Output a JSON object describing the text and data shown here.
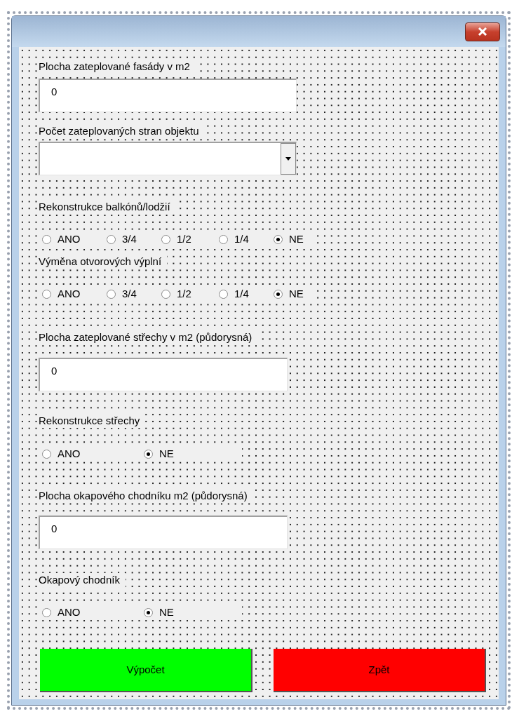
{
  "fields": [
    {
      "kind": "text",
      "label": "Plocha zateplované fasády v m2",
      "value": "0"
    },
    {
      "kind": "dropdown",
      "label": "Počet zateplovaných stran objektu"
    },
    {
      "kind": "radio",
      "label": "Rekonstrukce balkónů/lodžií",
      "options": [
        {
          "label": "ANO",
          "selected": false
        },
        {
          "label": "3/4",
          "selected": false
        },
        {
          "label": "1/2",
          "selected": false
        },
        {
          "label": "1/4",
          "selected": false
        },
        {
          "label": "NE",
          "selected": true
        }
      ]
    },
    {
      "kind": "radio",
      "label": "Výměna otvorových výplní",
      "options": [
        {
          "label": "ANO",
          "selected": false
        },
        {
          "label": "3/4",
          "selected": false
        },
        {
          "label": "1/2",
          "selected": false
        },
        {
          "label": "1/4",
          "selected": false
        },
        {
          "label": "NE",
          "selected": true
        }
      ]
    },
    {
      "kind": "text",
      "label": "Plocha zateplované střechy v m2 (půdorysná)",
      "value": "0"
    },
    {
      "kind": "radio",
      "label": "Rekonstrukce střechy",
      "options": [
        {
          "label": "ANO",
          "selected": false
        },
        {
          "label": "NE",
          "selected": true
        }
      ]
    },
    {
      "kind": "text",
      "label": "Plocha okapového chodníku m2 (půdorysná)",
      "value": "0"
    },
    {
      "kind": "radio",
      "label": "Okapový chodník",
      "options": [
        {
          "label": "ANO",
          "selected": false
        },
        {
          "label": "NE",
          "selected": true
        }
      ]
    }
  ],
  "buttons": [
    {
      "label": "Výpočet",
      "color": "#00ff00"
    },
    {
      "label": "Zpět",
      "color": "#ff0000"
    }
  ]
}
